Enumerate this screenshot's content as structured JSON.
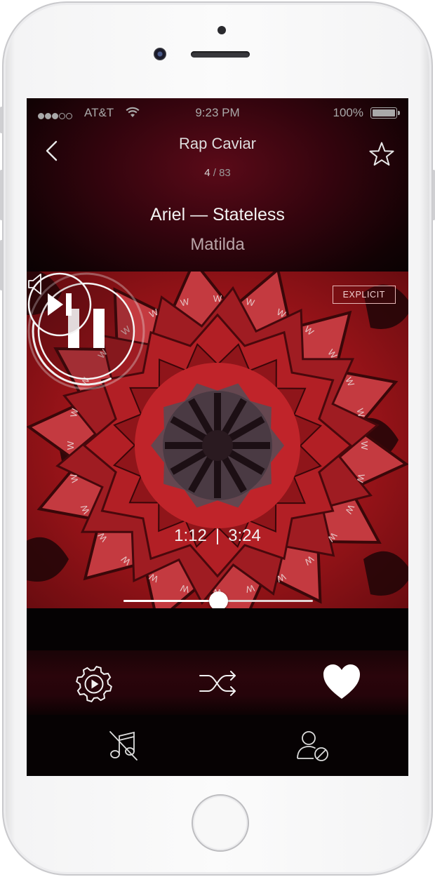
{
  "status_bar": {
    "carrier": "AT&T",
    "time": "9:23 PM",
    "battery": "100%",
    "signal_bars_filled": 3,
    "signal_bars_total": 5
  },
  "header": {
    "playlist_title": "Rap Caviar",
    "track_index": "4",
    "counter_separator": " / ",
    "track_count": "83",
    "track_line": "Ariel — Stateless",
    "album": "Matilda"
  },
  "player": {
    "explicit_label": "EXPLICIT",
    "elapsed": "1:12",
    "time_separator": "|",
    "duration": "3:24",
    "volume_fraction": 0.5
  },
  "icons": {
    "back": "chevron-left-icon",
    "favorite_playlist": "star-icon",
    "pause": "pause-icon",
    "skip": "skip-next-icon",
    "volume": "speaker-icon",
    "settings": "gear-play-icon",
    "shuffle": "shuffle-icon",
    "like": "heart-icon",
    "ban_song": "music-note-slash-icon",
    "ban_artist": "user-block-icon"
  },
  "colors": {
    "accent_red": "#c0242a",
    "background": "#050203"
  }
}
